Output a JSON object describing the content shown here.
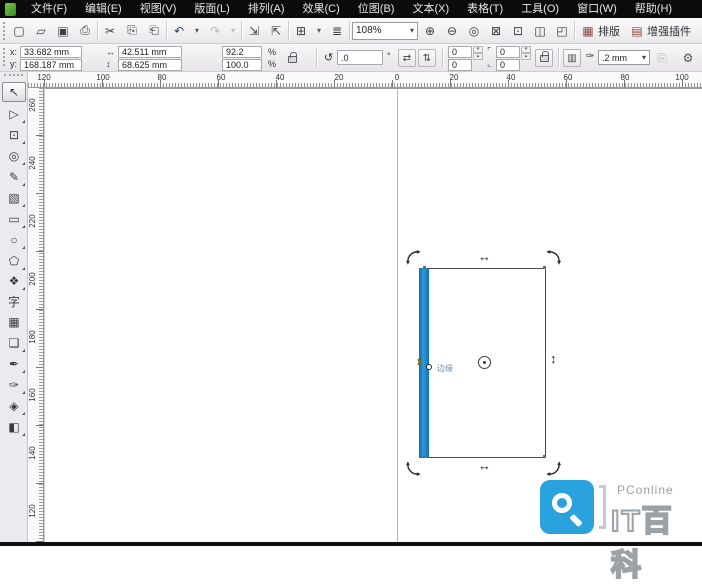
{
  "menu_bar": {
    "items": [
      "文件(F)",
      "编辑(E)",
      "视图(V)",
      "版面(L)",
      "排列(A)",
      "效果(C)",
      "位图(B)",
      "文本(X)",
      "表格(T)",
      "工具(O)",
      "窗口(W)",
      "帮助(H)"
    ]
  },
  "toolbar": {
    "zoom_level": "108%",
    "typeset_label": "排版",
    "plugin_label": "增强插件"
  },
  "property_bar": {
    "x_label": "x:",
    "x_value": "33.682 mm",
    "y_label": "y:",
    "y_value": "168.187 mm",
    "width_value": "42.511 mm",
    "height_value": "68.625 mm",
    "scale_h": "92.2",
    "scale_v": "100.0",
    "percent": "%",
    "rotation_value": ".0",
    "degree_symbol": "°",
    "corner_tl": "0",
    "corner_bl": "0",
    "corner_tr": "0",
    "corner_br": "0",
    "outline_width": ".2 mm"
  },
  "rulers": {
    "origin": "%",
    "h_labels": [
      "120",
      "100",
      "80",
      "60",
      "40",
      "20",
      "0",
      "20",
      "40",
      "60",
      "80",
      "100"
    ],
    "v_labels": [
      "260",
      "240",
      "220",
      "200",
      "180",
      "160",
      "140",
      "120"
    ]
  },
  "toolbox": {
    "tools": [
      {
        "name": "pick-tool",
        "glyph": "↖"
      },
      {
        "name": "shape-tool",
        "glyph": "▷"
      },
      {
        "name": "crop-tool",
        "glyph": "⊡"
      },
      {
        "name": "zoom-tool",
        "glyph": "◎"
      },
      {
        "name": "freehand-tool",
        "glyph": "✎"
      },
      {
        "name": "smart-fill-tool",
        "glyph": "▧"
      },
      {
        "name": "rectangle-tool",
        "glyph": "▭"
      },
      {
        "name": "ellipse-tool",
        "glyph": "○"
      },
      {
        "name": "polygon-tool",
        "glyph": "⬠"
      },
      {
        "name": "basic-shapes-tool",
        "glyph": "❖"
      },
      {
        "name": "text-tool",
        "glyph": "字"
      },
      {
        "name": "table-tool",
        "glyph": "▦"
      },
      {
        "name": "blend-tool",
        "glyph": "❏"
      },
      {
        "name": "eyedropper-tool",
        "glyph": "✒"
      },
      {
        "name": "outline-pen-tool",
        "glyph": "✑"
      },
      {
        "name": "fill-tool",
        "glyph": "◈"
      },
      {
        "name": "interactive-fill-tool",
        "glyph": "◧"
      }
    ]
  },
  "icons": {
    "new": "▢",
    "open": "▱",
    "save": "▣",
    "print": "⎙",
    "cut": "✂",
    "copy": "⎘",
    "paste": "⎗",
    "undo": "↶",
    "redo": "↷",
    "caret": "▾",
    "import": "⇲",
    "export": "⇱",
    "launcher": "⊞",
    "options": "≣",
    "zoom_in": "⊕",
    "zoom_out": "⊖",
    "zoom_one": "◎",
    "zoom_sel": "⊠",
    "zoom_all": "⊡",
    "zoom_page": "◫",
    "zoom_fit": "◰",
    "typeset": "▦",
    "plugin": "▤",
    "width": "↔",
    "height": "↕",
    "rotate": "↺",
    "mirror_h": "⇄",
    "mirror_v": "⇅",
    "bracket_top": "⌜",
    "bracket_bottom": "⌞",
    "wrap": "▥",
    "nib": "✑",
    "extra1": "⎘",
    "extra2": "⎙",
    "gear": "⚙",
    "spin_up": "▴",
    "spin_down": "▾",
    "arrow_h": "↔",
    "arrow_v": "↕",
    "skew_cursor": "⇕"
  },
  "canvas": {
    "selection_label": "边缘"
  },
  "watermark": {
    "brand": "PConline",
    "title": "IT百科"
  },
  "colors": {
    "selection_blue": "#1787cf",
    "watermark_blue": "#2aa2dd",
    "menu_bg": "#0b0b0b"
  }
}
